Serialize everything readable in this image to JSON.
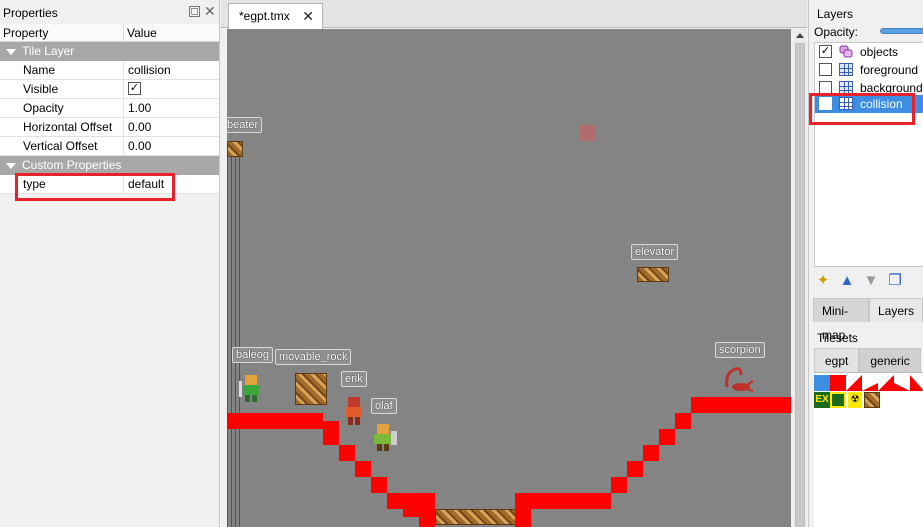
{
  "properties_panel": {
    "title": "Properties",
    "columns": {
      "property": "Property",
      "value": "Value"
    },
    "groups": {
      "tile_layer": "Tile Layer",
      "custom": "Custom Properties"
    },
    "rows": {
      "name": {
        "label": "Name",
        "value": "collision"
      },
      "visible": {
        "label": "Visible",
        "value": "✓"
      },
      "opacity": {
        "label": "Opacity",
        "value": "1.00"
      },
      "hoffset": {
        "label": "Horizontal Offset",
        "value": "0.00"
      },
      "voffset": {
        "label": "Vertical Offset",
        "value": "0.00"
      },
      "type": {
        "label": "type",
        "value": "default"
      }
    },
    "float_icon": "float-icon",
    "close_icon": "close-icon"
  },
  "editor": {
    "tab_title": "*egpt.tmx",
    "tab_close": "✕",
    "objects": {
      "beater": "beater",
      "elevator": "elevator",
      "baleog": "baleog",
      "movable_rock": "movable_rock",
      "erik": "erik",
      "olaf": "olaf",
      "scorpion": "scorpion"
    },
    "collision_color": "#ff0000"
  },
  "layers_panel": {
    "title": "Layers",
    "opacity_label": "Opacity:",
    "layers": [
      {
        "name": "objects",
        "visible": "✓",
        "icon": "object-layer-icon"
      },
      {
        "name": "foreground",
        "visible": "",
        "icon": "tile-layer-icon"
      },
      {
        "name": "background",
        "visible": "",
        "icon": "tile-layer-icon"
      },
      {
        "name": "collision",
        "visible": "✓",
        "icon": "tile-layer-icon",
        "selected": true
      }
    ],
    "tools": [
      "new-layer-icon",
      "raise-layer-icon",
      "lower-layer-icon",
      "duplicate-layer-icon"
    ],
    "tabs": {
      "minimap": "Mini-map",
      "layers": "Layers"
    },
    "tilesets_title": "Tilesets",
    "tileset_tabs": {
      "egpt": "egpt",
      "generic": "generic"
    }
  },
  "highlight_color": "#e8212b",
  "selection_color": "#3d8ee3"
}
